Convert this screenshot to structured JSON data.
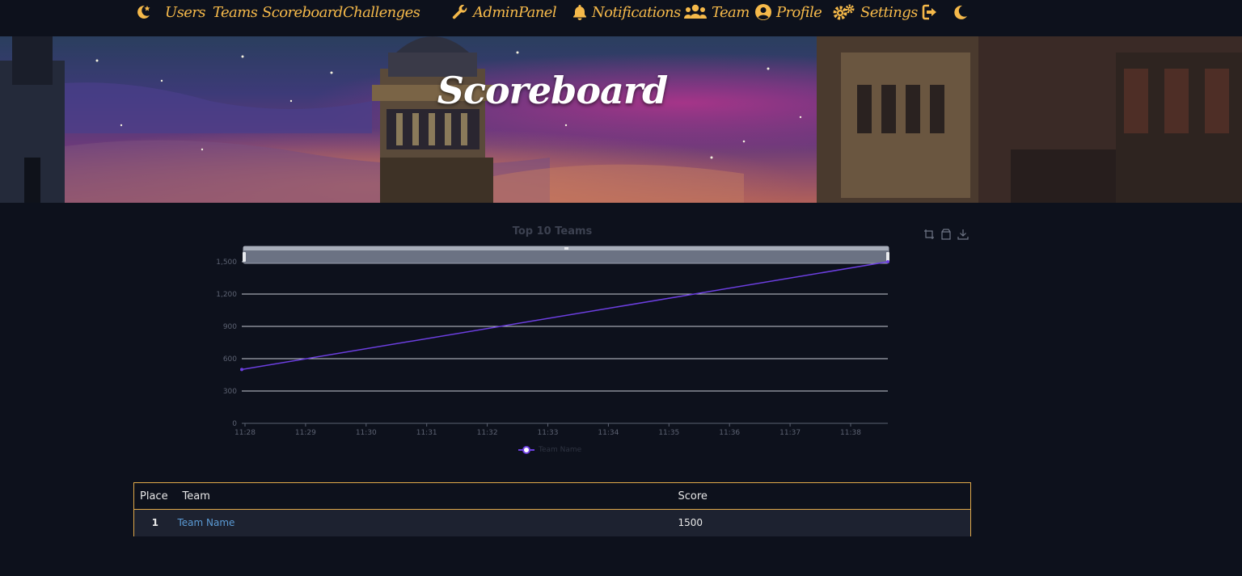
{
  "nav": {
    "items": [
      {
        "label": "Users"
      },
      {
        "label": "Teams"
      },
      {
        "label": "Scoreboard"
      },
      {
        "label": "Challenges"
      },
      {
        "label": "AdminPanel",
        "icon": "wrench-icon"
      },
      {
        "label": "Notifications",
        "icon": "bell-icon"
      },
      {
        "label": "Team",
        "icon": "users-icon"
      },
      {
        "label": "Profile",
        "icon": "user-circle-icon"
      },
      {
        "label": "Settings",
        "icon": "cogs-icon"
      }
    ],
    "icons": {
      "logo": "crescent-star-logo-icon",
      "logout": "sign-out-icon",
      "theme": "moon-icon"
    },
    "accent_color": "#f5b94a"
  },
  "hero": {
    "title": "Scoreboard"
  },
  "chart_data": {
    "type": "line",
    "title": "Top 10 Teams",
    "x": [
      "11:28",
      "11:29",
      "11:30",
      "11:31",
      "11:32",
      "11:33",
      "11:34",
      "11:35",
      "11:36",
      "11:37",
      "11:38"
    ],
    "yticks": [
      "0",
      "300",
      "600",
      "900",
      "1,200",
      "1,500"
    ],
    "ylim": [
      0,
      1500
    ],
    "series": [
      {
        "name": "Team Name",
        "color": "#6c3fe0",
        "points": [
          {
            "x": "11:28",
            "y": 500
          },
          {
            "x": "11:38",
            "y": 1500
          }
        ]
      }
    ],
    "legend_position": "bottom-center",
    "grid": true,
    "toolbox": [
      "zoom-icon",
      "zoom-reset-icon",
      "download-icon"
    ]
  },
  "scoreboard": {
    "headers": {
      "place": "Place",
      "team": "Team",
      "score": "Score"
    },
    "rows": [
      {
        "place": "1",
        "team": "Team Name",
        "score": "1500"
      }
    ],
    "border_color": "#e0a94a"
  }
}
